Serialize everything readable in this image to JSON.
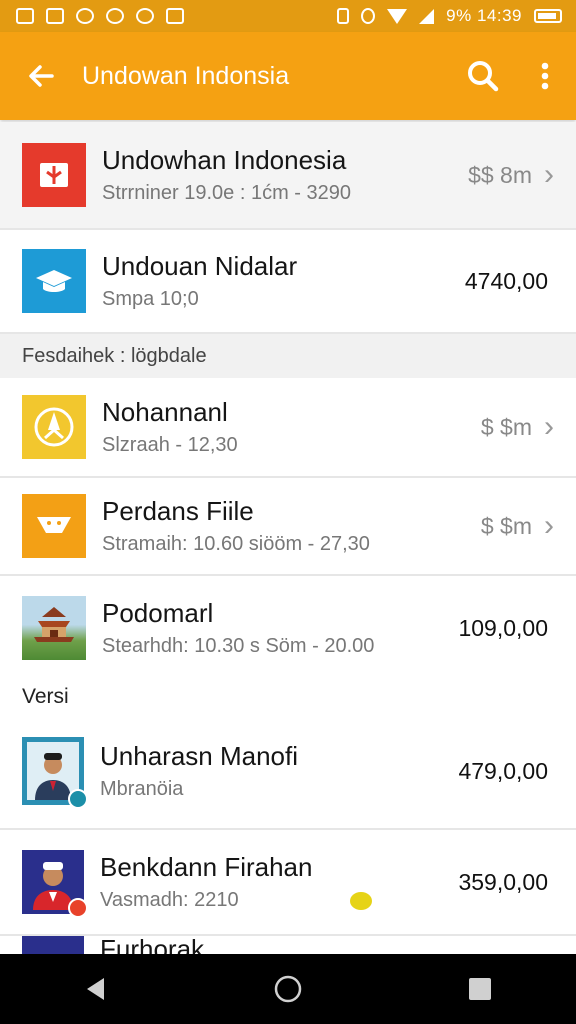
{
  "status_bar": {
    "right_text": "9% 14:39"
  },
  "toolbar": {
    "title": "Undowan Indonsia"
  },
  "rows_top": [
    {
      "title": "Undowhan Indonesia",
      "subtitle": "Strrniner 19.0e : 1ćm - 3290",
      "value": "$$ 8m",
      "chevron": true,
      "icon_color": "#e53a2c"
    },
    {
      "title": "Undouan Nidalar",
      "subtitle": "Smpa 10;0",
      "value": "4740,00",
      "chevron": false,
      "icon_color": "#1e9bd6"
    }
  ],
  "section_header": "Fesdaihek : lögbdale",
  "rows_mid": [
    {
      "title": "Nohannanl",
      "subtitle": "Slzraah - 12,30",
      "value": "$ $m",
      "chevron": true,
      "icon_color": "#f2c72e"
    },
    {
      "title": "Perdans Fiile",
      "subtitle": "Stramaih: 10.60 siööm - 27,30",
      "value": "$ $m",
      "chevron": true,
      "icon_color": "#f3a015"
    },
    {
      "title": "Podomarl",
      "subtitle": "Stearhdh: 10.30 s Söm - 20.00",
      "value": "109,0,00",
      "chevron": false,
      "icon_color": "#7fb05a"
    }
  ],
  "section_plain": "Versi",
  "rows_bottom": [
    {
      "title": "Unharasn Manofi",
      "subtitle": "Mbranöia",
      "value": "479,0,00",
      "icon_color": "#2b8fb3",
      "badge_color": "#1c8fa8"
    },
    {
      "title": "Benkdann Firahan",
      "subtitle": "Vasmadh: 2210",
      "value": "359,0,00",
      "icon_color": "#2a2f8c",
      "badge_color": "#e8422a"
    }
  ],
  "partial_row_title": "Furhorak"
}
